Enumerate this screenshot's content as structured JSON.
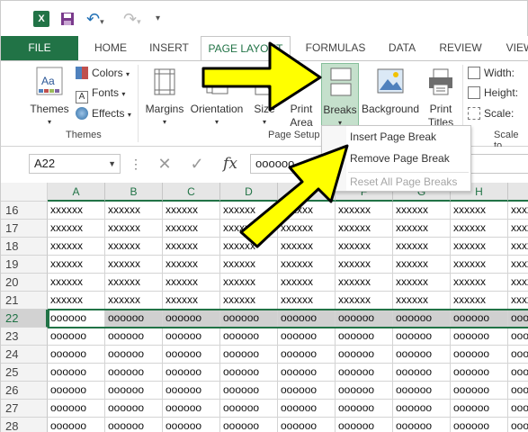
{
  "ribbon_tabs": [
    {
      "label": "FILE"
    },
    {
      "label": "HOME"
    },
    {
      "label": "INSERT"
    },
    {
      "label": "PAGE LAYOUT"
    },
    {
      "label": "FORMULAS"
    },
    {
      "label": "DATA"
    },
    {
      "label": "REVIEW"
    },
    {
      "label": "VIEW"
    }
  ],
  "ribbon": {
    "themes_group": {
      "themes_label": "Themes",
      "colors_label": "Colors",
      "fonts_label": "Fonts",
      "effects_label": "Effects",
      "group_label": "Themes"
    },
    "page_setup": {
      "margins_label": "Margins",
      "orientation_label": "Orientation",
      "size_label": "Size",
      "print_area_line1": "Print",
      "print_area_line2": "Area",
      "breaks_label": "Breaks",
      "background_label": "Background",
      "print_titles_line1": "Print",
      "print_titles_line2": "Titles",
      "group_label": "Page Setup"
    },
    "scale_group": {
      "width_label": "Width:",
      "height_label": "Height:",
      "scale_label": "Scale:",
      "group_label": "Scale to"
    }
  },
  "breaks_menu": {
    "items": [
      {
        "label": "Insert Page Break",
        "enabled": true
      },
      {
        "label": "Remove Page Break",
        "enabled": true
      },
      {
        "label": "Reset All Page Breaks",
        "enabled": false
      }
    ]
  },
  "formula_bar": {
    "name_box": "A22",
    "cancel_symbol": "✕",
    "enter_symbol": "✓",
    "fx_symbol": "fx",
    "content": "oooooo"
  },
  "sheet": {
    "columns": [
      "A",
      "B",
      "C",
      "D",
      "E",
      "F",
      "G",
      "H",
      "I"
    ],
    "rows": [
      {
        "num": "16",
        "fill": "xxxxxx"
      },
      {
        "num": "17",
        "fill": "xxxxxx"
      },
      {
        "num": "18",
        "fill": "xxxxxx"
      },
      {
        "num": "19",
        "fill": "xxxxxx"
      },
      {
        "num": "20",
        "fill": "xxxxxx"
      },
      {
        "num": "21",
        "fill": "xxxxxx"
      },
      {
        "num": "22",
        "fill": "oooooo"
      },
      {
        "num": "23",
        "fill": "oooooo"
      },
      {
        "num": "24",
        "fill": "oooooo"
      },
      {
        "num": "25",
        "fill": "oooooo"
      },
      {
        "num": "26",
        "fill": "oooooo"
      },
      {
        "num": "27",
        "fill": "oooooo"
      },
      {
        "num": "28",
        "fill": "oooooo"
      }
    ],
    "selected_row": "22"
  },
  "colors": {
    "excel_green": "#217346",
    "arrow_yellow": "#ffff00",
    "breaks_highlight": "#c5e0cc"
  }
}
